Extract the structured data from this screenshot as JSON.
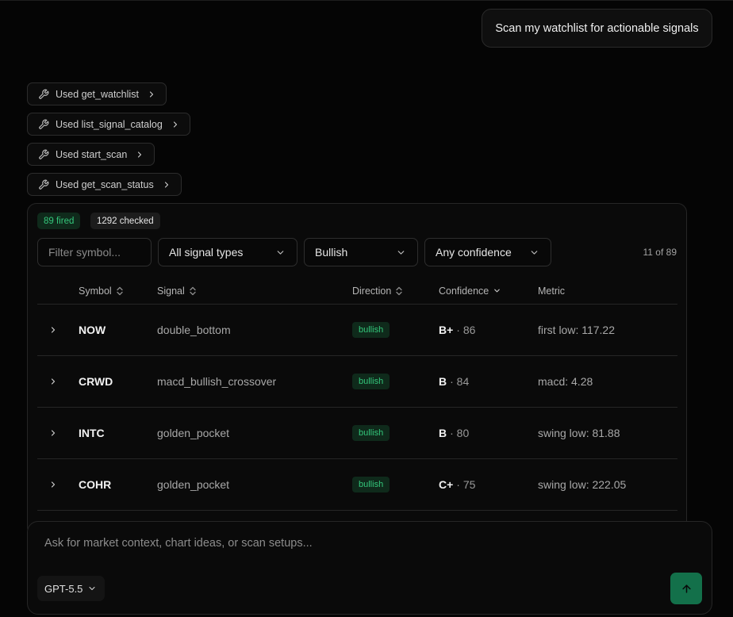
{
  "user_message": "Scan my watchlist for actionable signals",
  "tool_calls": [
    {
      "label": "Used get_watchlist"
    },
    {
      "label": "Used list_signal_catalog"
    },
    {
      "label": "Used start_scan"
    },
    {
      "label": "Used get_scan_status"
    }
  ],
  "results": {
    "fired_badge": "89 fired",
    "checked_badge": "1292 checked",
    "filters": {
      "symbol_placeholder": "Filter symbol...",
      "signal_type": "All signal types",
      "direction": "Bullish",
      "confidence": "Any confidence"
    },
    "count": "11 of 89",
    "columns": {
      "symbol": "Symbol",
      "signal": "Signal",
      "direction": "Direction",
      "confidence": "Confidence",
      "metric": "Metric"
    },
    "rows": [
      {
        "symbol": "NOW",
        "signal": "double_bottom",
        "direction": "bullish",
        "grade": "B+",
        "score": "· 86",
        "metric": "first low: 117.22"
      },
      {
        "symbol": "CRWD",
        "signal": "macd_bullish_crossover",
        "direction": "bullish",
        "grade": "B",
        "score": "· 84",
        "metric": "macd: 4.28"
      },
      {
        "symbol": "INTC",
        "signal": "golden_pocket",
        "direction": "bullish",
        "grade": "B",
        "score": "· 80",
        "metric": "swing low: 81.88"
      },
      {
        "symbol": "COHR",
        "signal": "golden_pocket",
        "direction": "bullish",
        "grade": "C+",
        "score": "· 75",
        "metric": "swing low: 222.05"
      }
    ]
  },
  "composer": {
    "placeholder": "Ask for market context, chart ideas, or scan setups...",
    "model": "GPT-5.5"
  },
  "colors": {
    "background": "#050505",
    "accent_green": "#34c77b",
    "badge_green_bg": "#0f2a1b",
    "send_button": "#13704a"
  },
  "icons": [
    "wrench-icon",
    "chevron-right-icon",
    "chevron-down-icon",
    "sort-icon",
    "arrow-up-icon"
  ]
}
